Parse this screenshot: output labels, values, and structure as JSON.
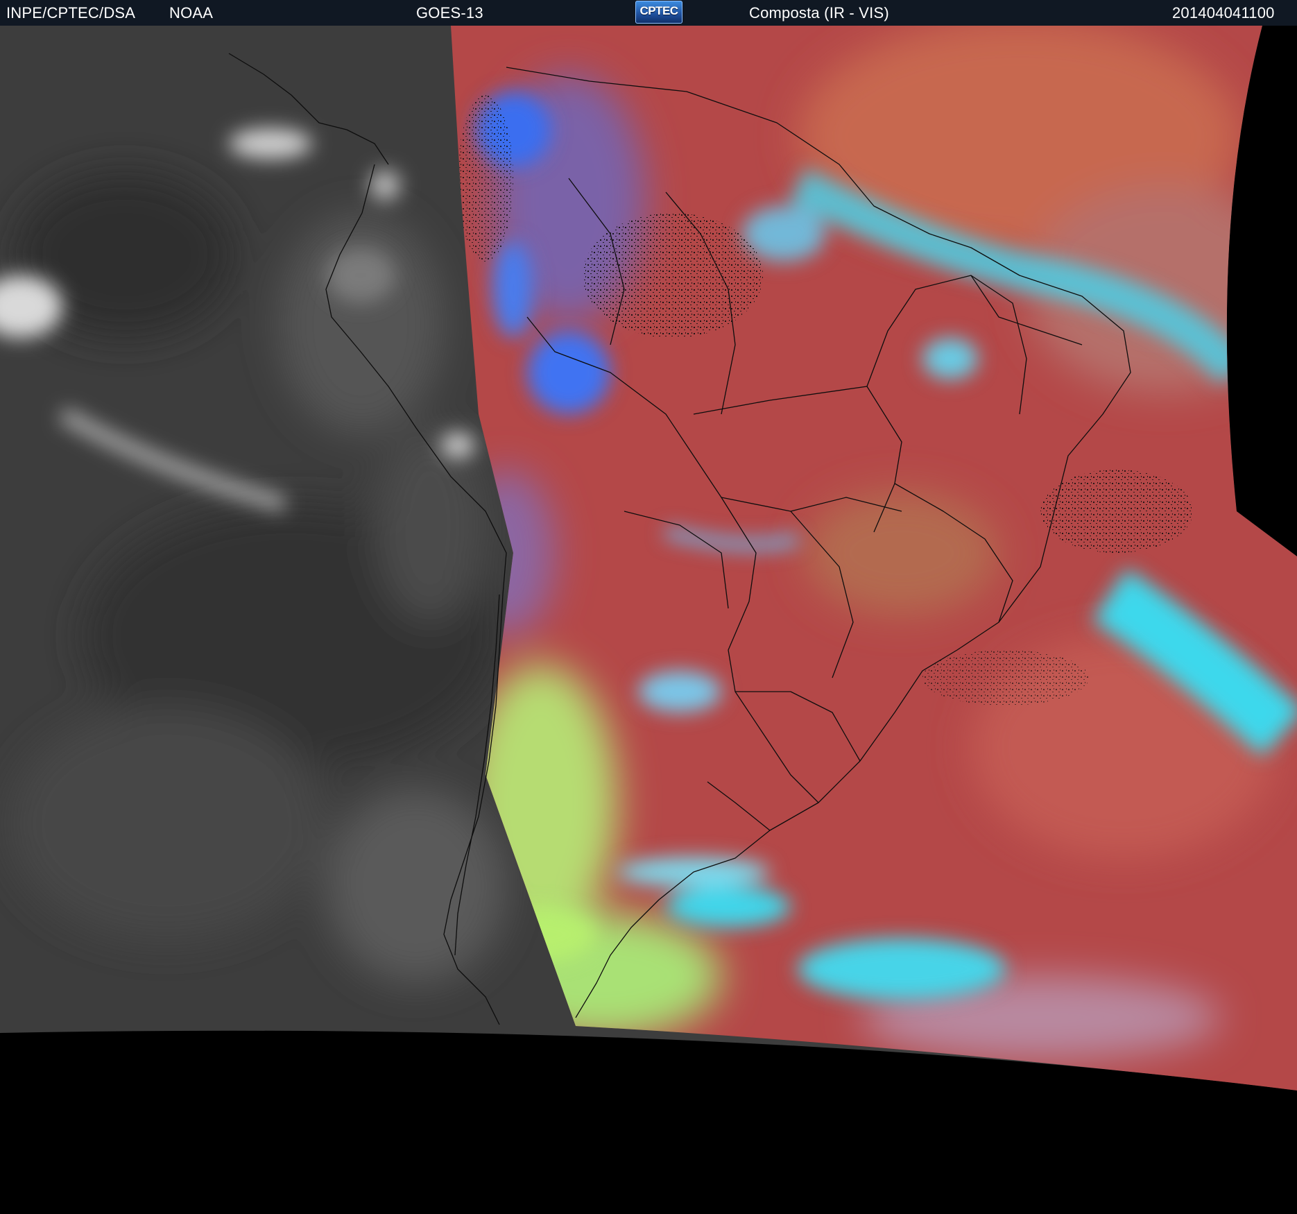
{
  "header": {
    "institution": "INPE/CPTEC/DSA",
    "agency": "NOAA",
    "satellite": "GOES-13",
    "logo_text": "CPTEC",
    "product": "Composta (IR - VIS)",
    "timestamp": "201404041100"
  },
  "colors": {
    "header_bg": "#101823",
    "header_text": "#ffffff",
    "ir_gray": "#404040",
    "composite_red": "#b44848",
    "cloud_cyan": "#3ed8ec",
    "cloud_blue": "#3a6ef0",
    "cloud_green": "#aeea6e",
    "outside_disk": "#000000",
    "borders": "#0d0d0d"
  }
}
